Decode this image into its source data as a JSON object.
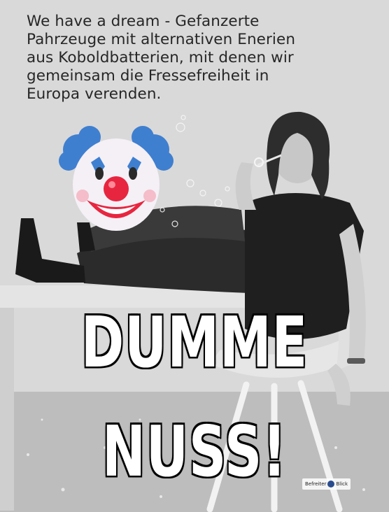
{
  "caption": {
    "lines": [
      "We have a dream - Gefanzerte",
      "Pahrzeuge mit alternativen Enerien",
      "aus Koboldbatterien, mit denen wir",
      "gemeinsam die Fressefreiheit in",
      "Europa verenden."
    ]
  },
  "impact": {
    "line1": "DUMME",
    "line2": "NUSS!"
  },
  "watermark": {
    "left": "Befreiter",
    "right": "Blick"
  },
  "icons": {
    "clown": "clown-face-emoji"
  }
}
